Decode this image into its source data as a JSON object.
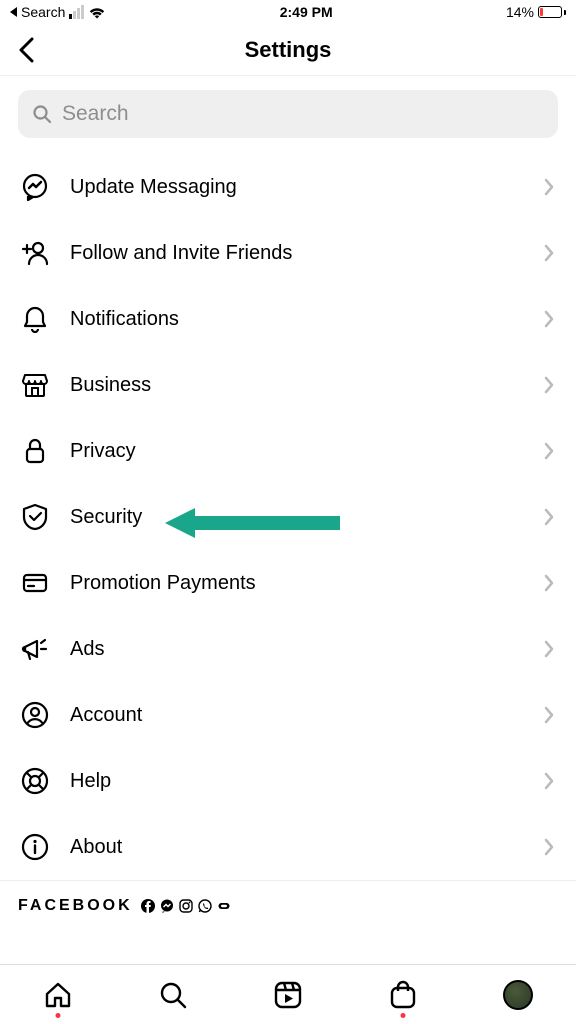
{
  "status": {
    "back_label": "Search",
    "time": "2:49 PM",
    "battery_pct": "14%"
  },
  "header": {
    "title": "Settings"
  },
  "search": {
    "placeholder": "Search"
  },
  "settings": [
    {
      "icon": "messenger",
      "label": "Update Messaging"
    },
    {
      "icon": "follow",
      "label": "Follow and Invite Friends"
    },
    {
      "icon": "bell",
      "label": "Notifications"
    },
    {
      "icon": "business",
      "label": "Business"
    },
    {
      "icon": "lock",
      "label": "Privacy"
    },
    {
      "icon": "shield",
      "label": "Security"
    },
    {
      "icon": "card",
      "label": "Promotion Payments"
    },
    {
      "icon": "megaphone",
      "label": "Ads"
    },
    {
      "icon": "account",
      "label": "Account"
    },
    {
      "icon": "help",
      "label": "Help"
    },
    {
      "icon": "info",
      "label": "About"
    }
  ],
  "footer": {
    "brand": "FACEBOOK"
  },
  "annotation": {
    "color": "#1aa68a"
  }
}
